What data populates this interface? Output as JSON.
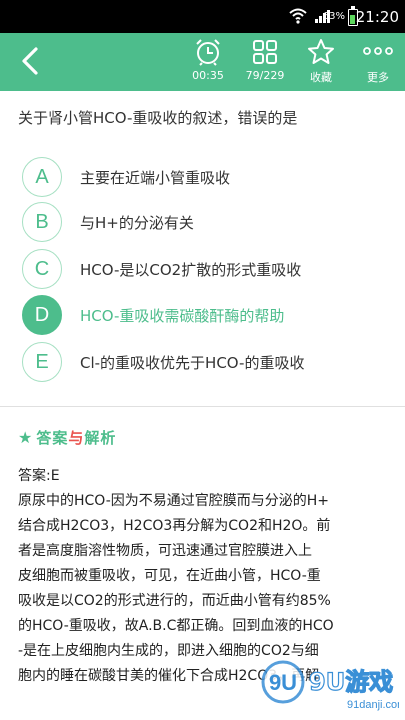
{
  "status_bar": {
    "battery_pct": "63%",
    "time": "21:20",
    "icons": [
      "wifi-icon",
      "signal-icon",
      "battery-icon"
    ]
  },
  "toolbar": {
    "back_icon": "chevron-left-icon",
    "timer_label": "00:35",
    "progress_label": "79/229",
    "favorite_label": "收藏",
    "more_label": "更多"
  },
  "question": {
    "title": "关于肾小管HCO-重吸收的叙述，错误的是",
    "options": [
      {
        "letter": "A",
        "text": "主要在近端小管重吸收"
      },
      {
        "letter": "B",
        "text": "与H+的分泌有关"
      },
      {
        "letter": "C",
        "text": "HCO-是以CO2扩散的形式重吸收"
      },
      {
        "letter": "D",
        "text": "HCO-重吸收需碳酸酐酶的帮助"
      },
      {
        "letter": "E",
        "text": "Cl-的重吸收优先于HCO-的重吸收"
      }
    ],
    "selected": "D"
  },
  "analysis": {
    "header_star": "★",
    "header_part1": "答案",
    "header_part2": "与",
    "header_part3": "解析",
    "answer": "答案:E",
    "lines": [
      "原尿中的HCO-因为不易通过官腔膜而与分泌的H+",
      "结合成H2CO3，H2CO3再分解为CO2和H2O。前",
      "者是高度脂溶性物质，可迅速通过官腔膜进入上",
      "皮细胞而被重吸收，可见，在近曲小管，HCO-重",
      "吸收是以CO2的形式进行的，而近曲小管有约85%",
      "的HCO-重吸收，故A.B.C都正确。回到血液的HCO",
      "-是在上皮细胞内生成的，即进入细胞的CO2与细",
      "胞内的睡在碳酸甘美的催化下合成H2CO3，再解"
    ]
  },
  "watermark": {
    "logo_text": "9U游戏",
    "url": "91danji.com"
  },
  "colors": {
    "accent": "#4dbd8c",
    "accent_light": "#a6e0c3",
    "red": "#e9534e"
  }
}
